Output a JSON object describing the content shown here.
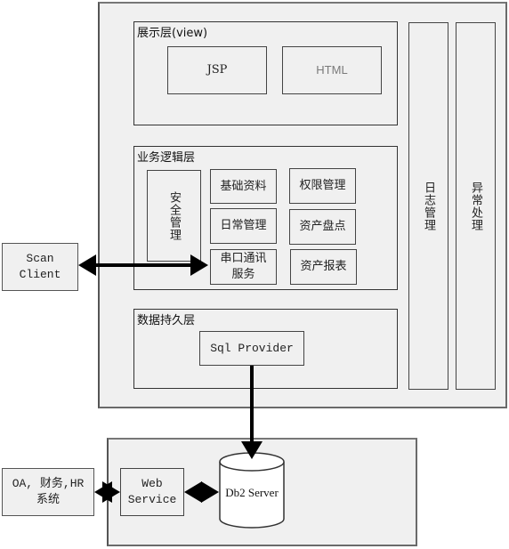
{
  "diagram": {
    "type": "system-architecture",
    "app_server": {
      "presentation_layer": {
        "title": "展示层(view)",
        "modules": [
          "JSP",
          "HTML"
        ]
      },
      "business_layer": {
        "title": "业务逻辑层",
        "security": "安全管理",
        "modules": [
          "基础资料",
          "权限管理",
          "日常管理",
          "资产盘点",
          "串口通讯服务",
          "资产报表"
        ],
        "serial_line1": "串口通讯",
        "serial_line2": "服务"
      },
      "persistence_layer": {
        "title": "数据持久层",
        "provider": "Sql Provider"
      },
      "cross_cutting": [
        "日志管理",
        "异常处理"
      ]
    },
    "external": {
      "scan_client_line1": "Scan",
      "scan_client_line2": "Client",
      "oa_line1": "OA, 财务,HR",
      "oa_line2": "系统"
    },
    "db_server": {
      "web_service_line1": "Web",
      "web_service_line2": "Service",
      "database": "Db2 Server"
    },
    "connections": [
      {
        "from": "Scan Client",
        "to": "串口通讯服务",
        "direction": "bidirectional"
      },
      {
        "from": "Sql Provider",
        "to": "Db2 Server",
        "direction": "one-way"
      },
      {
        "from": "OA, 财务,HR 系统",
        "to": "Web Service",
        "direction": "bidirectional"
      },
      {
        "from": "Web Service",
        "to": "Db2 Server",
        "direction": "bidirectional"
      }
    ]
  }
}
